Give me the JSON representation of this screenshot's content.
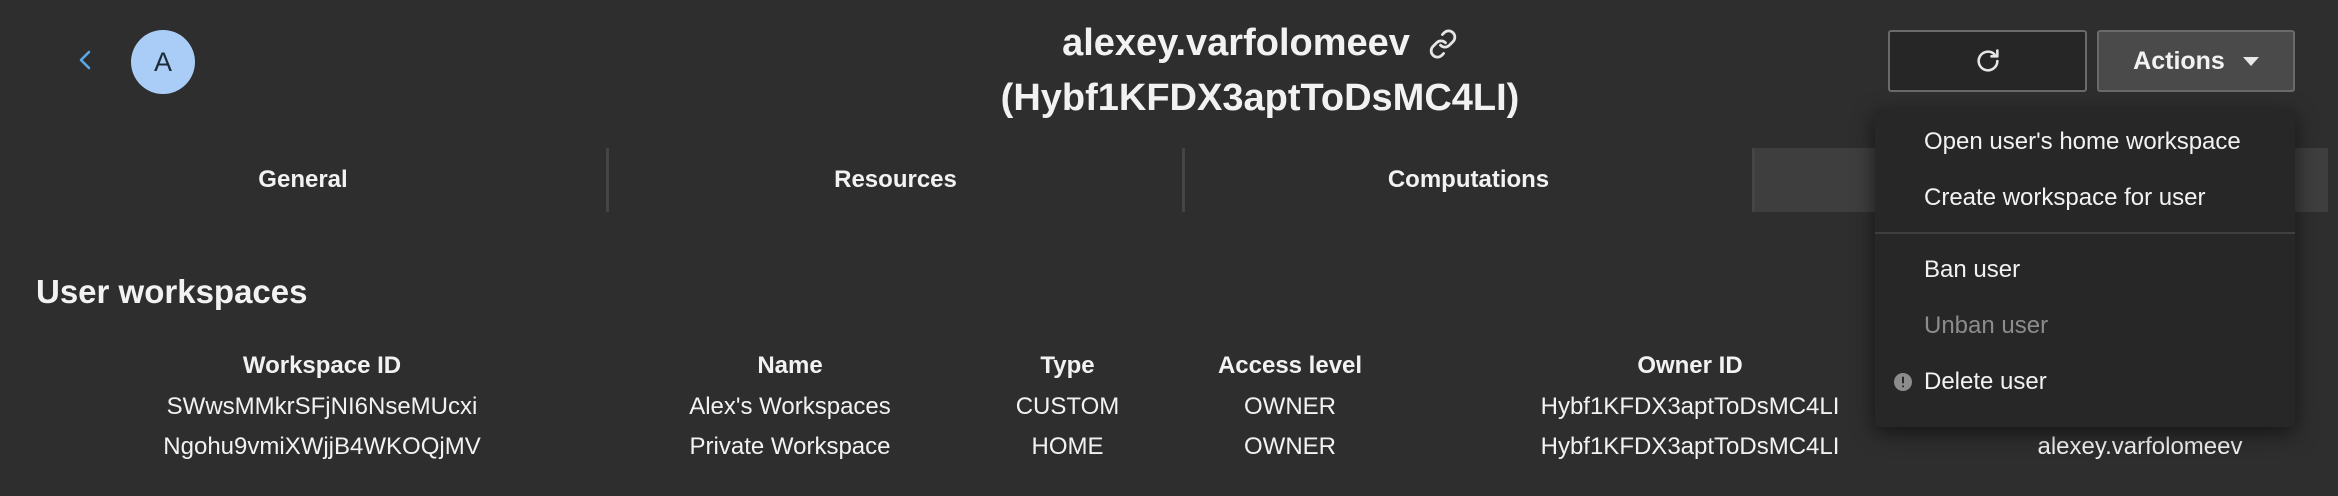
{
  "header": {
    "avatar_letter": "A",
    "username": "alexey.varfolomeev",
    "user_id": "(Hybf1KFDX3aptToDsMC4LI)",
    "actions_label": "Actions"
  },
  "tabs": [
    {
      "label": "General"
    },
    {
      "label": "Resources"
    },
    {
      "label": "Computations"
    },
    {
      "label": ""
    }
  ],
  "section_title": "User workspaces",
  "table": {
    "columns": [
      "Workspace ID",
      "Name",
      "Type",
      "Access level",
      "Owner ID"
    ],
    "rows": [
      [
        "SWwsMMkrSFjNI6NseMUcxi",
        "Alex's Workspaces",
        "CUSTOM",
        "OWNER",
        "Hybf1KFDX3aptToDsMC4LI",
        ""
      ],
      [
        "Ngohu9vmiXWjjB4WKOQjMV",
        "Private Workspace",
        "HOME",
        "OWNER",
        "Hybf1KFDX3aptToDsMC4LI",
        "alexey.varfolomeev"
      ]
    ]
  },
  "actions_menu": {
    "items": [
      {
        "label": "Open user's home workspace",
        "enabled": true
      },
      {
        "label": "Create workspace for user",
        "enabled": true
      },
      {
        "label": "Ban user",
        "enabled": true
      },
      {
        "label": "Unban user",
        "enabled": false
      },
      {
        "label": "Delete user",
        "enabled": true
      }
    ]
  },
  "colors": {
    "background": "#2e2e2e",
    "accent": "#5aa9e6",
    "avatar_bg": "#a9cdf7",
    "menu_bg": "#272727"
  },
  "icons": [
    "chevron-left-icon",
    "link-icon",
    "refresh-icon",
    "caret-down-icon",
    "warning-icon"
  ]
}
